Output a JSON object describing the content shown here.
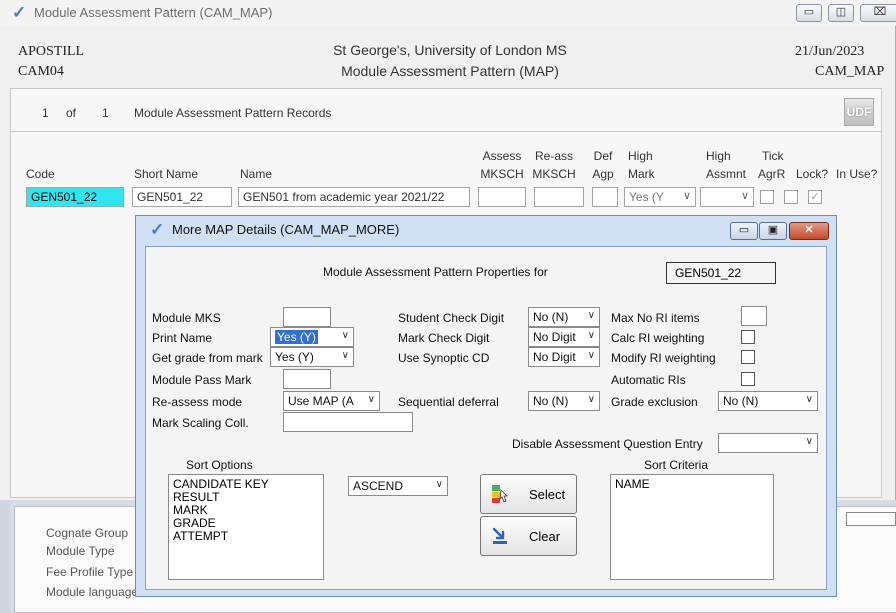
{
  "main": {
    "title": "Module Assessment Pattern (CAM_MAP)",
    "left_line1": "APOSTILL",
    "left_line2": "CAM04",
    "center_line1": "St George's, University of London MS",
    "center_line2": "Module Assessment Pattern (MAP)",
    "right_line1": "21/Jun/2023",
    "right_line2": "CAM_MAP",
    "record_current": "1",
    "record_of": "of",
    "record_total": "1",
    "record_label": "Module Assessment Pattern Records",
    "udf_label": "UDF",
    "columns": {
      "code": "Code",
      "short_name": "Short Name",
      "name": "Name",
      "assess_1": "Assess",
      "assess_2": "MKSCH",
      "reass_1": "Re-ass",
      "reass_2": "MKSCH",
      "def_1": "Def",
      "def_2": "Agp",
      "high_mark_1": "High",
      "high_mark_2": "Mark",
      "high_assmnt_1": "High",
      "high_assmnt_2": "Assmnt",
      "tick_1": "Tick",
      "tick_2": "AgrR",
      "lock": "Lock?",
      "in_use": "In Use?"
    },
    "row": {
      "code": "GEN501_22",
      "short_name": "GEN501_22",
      "name": "GEN501 from academic year 2021/22",
      "high_mark": "Yes (Y"
    },
    "lower_labels": [
      "Cognate Group",
      "Module Type",
      "Fee Profile Type",
      "Module language"
    ]
  },
  "dialog": {
    "title": "More MAP Details (CAM_MAP_MORE)",
    "heading": "Module Assessment Pattern Properties for",
    "code": "GEN501_22",
    "labels": {
      "module_mks": "Module MKS",
      "print_name": "Print Name",
      "get_grade": "Get grade from mark",
      "pass_mark": "Module Pass Mark",
      "reassess_mode": "Re-assess mode",
      "mark_scaling": "Mark Scaling Coll.",
      "student_check": "Student Check Digit",
      "mark_check": "Mark Check Digit",
      "use_synoptic": "Use Synoptic CD",
      "seq_deferral": "Sequential deferral",
      "max_ri": "Max No RI items",
      "calc_ri": "Calc RI weighting",
      "modify_ri": "Modify RI weighting",
      "auto_ri": "Automatic RIs",
      "grade_excl": "Grade exclusion",
      "disable_aqe": "Disable Assessment Question Entry",
      "sort_options": "Sort Options",
      "sort_criteria": "Sort Criteria"
    },
    "values": {
      "print_name": "Yes (Y)",
      "get_grade": "Yes (Y)",
      "reassess_mode": "Use MAP (A",
      "student_check": "No (N)",
      "mark_check": "No Digit",
      "use_synoptic": "No Digit",
      "seq_deferral": "No (N)",
      "grade_excl": "No (N)",
      "sort_order": "ASCEND"
    },
    "sort_options": [
      "CANDIDATE KEY",
      "RESULT",
      "MARK",
      "GRADE",
      "ATTEMPT"
    ],
    "sort_criteria": [
      "NAME"
    ],
    "buttons": {
      "select": "Select",
      "clear": "Clear"
    }
  }
}
